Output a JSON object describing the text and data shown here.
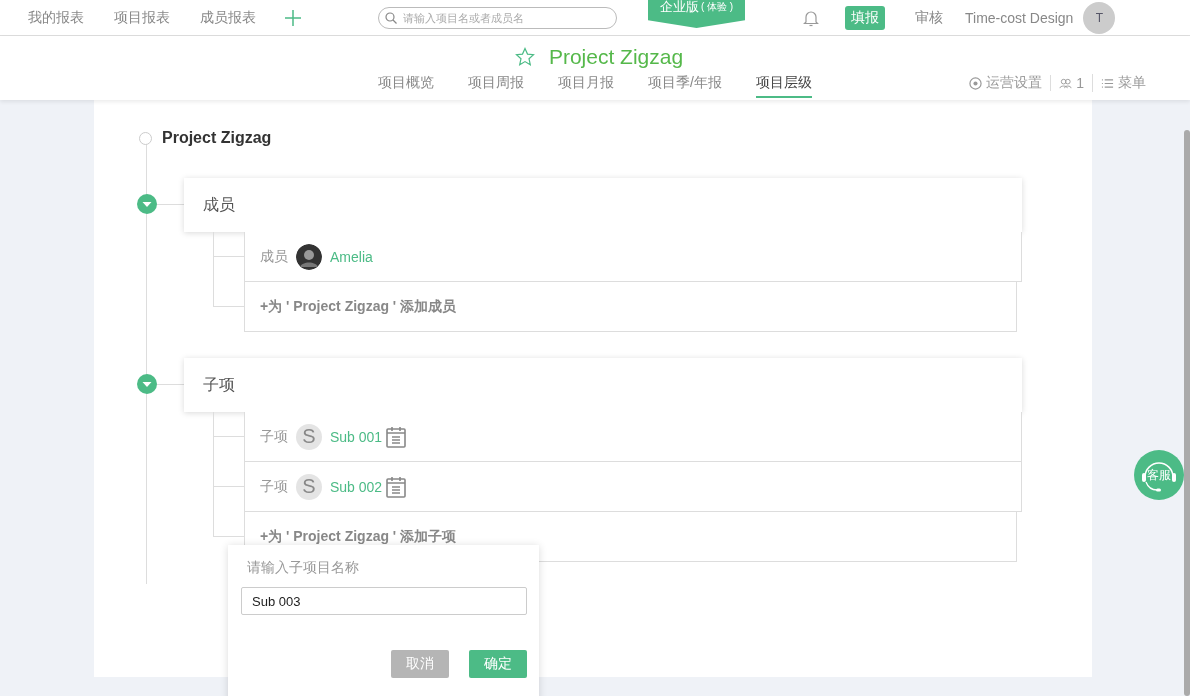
{
  "top_nav": {
    "links": [
      {
        "label": "我的报表"
      },
      {
        "label": "项目报表"
      },
      {
        "label": "成员报表"
      }
    ]
  },
  "search": {
    "placeholder": "请输入项目名或者成员名"
  },
  "edition_badge": {
    "label": "企业版",
    "note": "( 体验 )"
  },
  "actions": [
    {
      "label": "填报",
      "selected": true
    },
    {
      "label": "审核",
      "selected": false
    }
  ],
  "user": {
    "name": "Time-cost Design",
    "initial": "T"
  },
  "project": {
    "title": "Project Zigzag",
    "starred": false
  },
  "tabs": [
    {
      "label": "项目概览",
      "selected": false
    },
    {
      "label": "项目周报",
      "selected": false
    },
    {
      "label": "项目月报",
      "selected": false
    },
    {
      "label": "项目季/年报",
      "selected": false
    },
    {
      "label": "项目层级",
      "selected": true
    }
  ],
  "tools": [
    {
      "kind": "settings",
      "label": "运营设置"
    },
    {
      "kind": "members",
      "label": "1"
    },
    {
      "kind": "menu",
      "label": "菜单"
    }
  ],
  "tree": {
    "root": "Project Zigzag",
    "sections": [
      {
        "title": "成员",
        "expanded": true,
        "children": [
          {
            "kind": "member",
            "type_label": "成员",
            "name": "Amelia"
          },
          {
            "kind": "add",
            "label": "+为 ' Project Zigzag ' 添加成员"
          }
        ]
      },
      {
        "title": "子项",
        "expanded": true,
        "children": [
          {
            "kind": "sub",
            "type_label": "子项",
            "initial": "S",
            "name": "Sub 001"
          },
          {
            "kind": "sub",
            "type_label": "子项",
            "initial": "S",
            "name": "Sub 002"
          },
          {
            "kind": "add",
            "label": "+为 ' Project Zigzag ' 添加子项"
          }
        ]
      }
    ]
  },
  "dialog": {
    "label": "请输入子项目名称",
    "value": "Sub 003",
    "buttons": [
      {
        "kind": "cancel",
        "label": "取消"
      },
      {
        "kind": "primary",
        "label": "确定"
      }
    ]
  },
  "support_button": {
    "label": "客服"
  }
}
